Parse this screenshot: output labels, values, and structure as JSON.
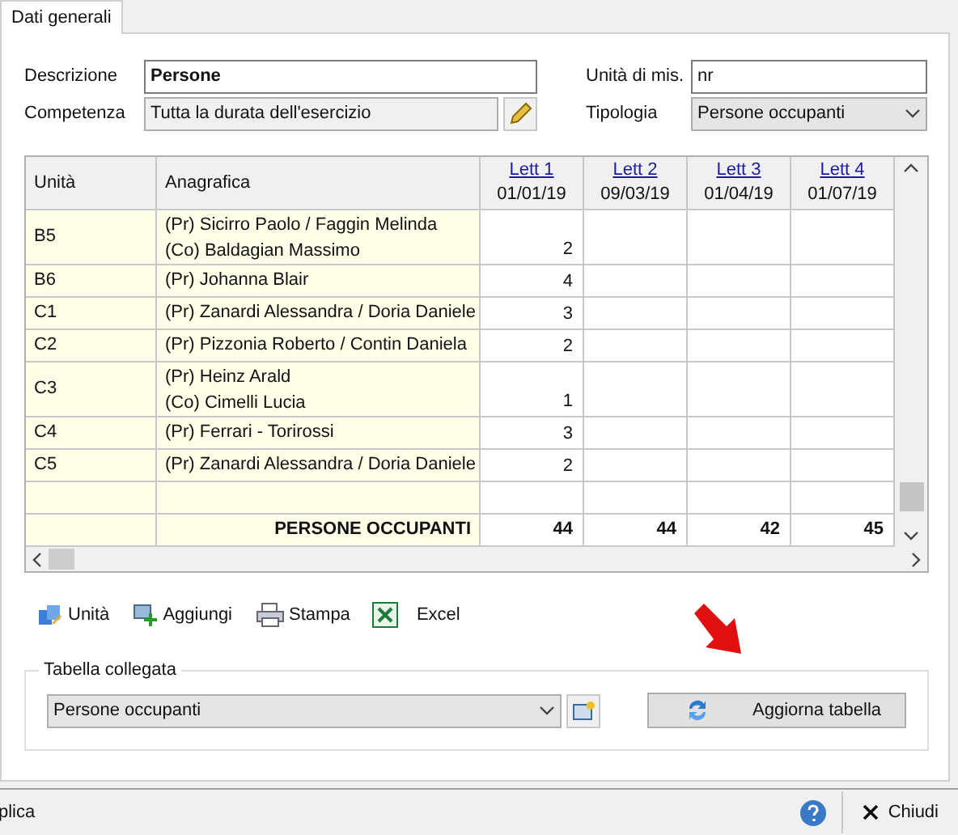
{
  "tabs": [
    {
      "label": "Dati generali",
      "selected": true
    }
  ],
  "form": {
    "descrizione": {
      "label": "Descrizione",
      "value": "Persone"
    },
    "unita": {
      "label": "Unità di mis.",
      "value": "nr"
    },
    "competenza": {
      "label": "Competenza",
      "value": "Tutta la durata dell'esercizio"
    },
    "tipologia": {
      "label": "Tipologia",
      "value": "Persone occupanti"
    }
  },
  "table": {
    "columns": [
      {
        "label": "Unità"
      },
      {
        "label": "Anagrafica"
      },
      {
        "link": "Lett 1",
        "date": "01/01/19"
      },
      {
        "link": "Lett 2",
        "date": "09/03/19"
      },
      {
        "link": "Lett 3",
        "date": "01/04/19"
      },
      {
        "link": "Lett 4",
        "date": "01/07/19"
      }
    ],
    "rows": [
      {
        "kind": "entry",
        "unit": "B5",
        "names": [
          "(Pr) Sicirro Paolo / Faggin Melinda",
          "(Co) Baldagian Massimo"
        ],
        "values": [
          "2"
        ]
      },
      {
        "kind": "entry",
        "unit": "B6",
        "names": [
          "(Pr) Johanna Blair"
        ],
        "values": [
          "4"
        ]
      },
      {
        "kind": "entry",
        "unit": "C1",
        "names": [
          "(Pr) Zanardi Alessandra / Doria Daniele"
        ],
        "values": [
          "3"
        ]
      },
      {
        "kind": "entry",
        "unit": "C2",
        "names": [
          "(Pr) Pizzonia Roberto / Contin Daniela"
        ],
        "values": [
          "2"
        ]
      },
      {
        "kind": "entry",
        "unit": "C3",
        "names": [
          "(Pr) Heinz Arald",
          "(Co) Cimelli Lucia"
        ],
        "values": [
          "1"
        ]
      },
      {
        "kind": "entry",
        "unit": "C4",
        "names": [
          "(Pr) Ferrari - Torirossi"
        ],
        "values": [
          "3"
        ]
      },
      {
        "kind": "entry",
        "unit": "C5",
        "names": [
          "(Pr) Zanardi Alessandra / Doria Daniele"
        ],
        "values": [
          "2"
        ]
      },
      {
        "kind": "blank"
      }
    ],
    "total": {
      "label": "PERSONE OCCUPANTI",
      "values": [
        "44",
        "44",
        "42",
        "45"
      ]
    }
  },
  "toolbar": [
    {
      "kind": "units",
      "label": "Unità"
    },
    {
      "kind": "add",
      "label": "Aggiungi"
    },
    {
      "kind": "print",
      "label": "Stampa"
    },
    {
      "kind": "excel",
      "label": "Excel"
    }
  ],
  "linked": {
    "title": "Tabella collegata",
    "value": "Persone occupanti",
    "button": "Aggiorna tabella"
  },
  "status_bar": {
    "left": "plica",
    "close": "Chiudi"
  }
}
